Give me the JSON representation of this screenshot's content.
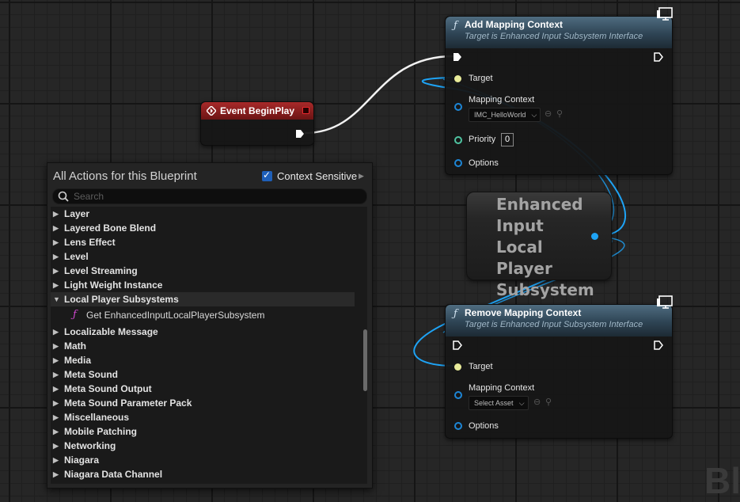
{
  "watermark": "Bl",
  "event_node": {
    "title": "Event BeginPlay"
  },
  "add_node": {
    "title": "Add Mapping Context",
    "subtitle": "Target is Enhanced Input Subsystem Interface",
    "pins": {
      "target": "Target",
      "mapping_context": "Mapping Context",
      "priority": "Priority",
      "options": "Options"
    },
    "mapping_value": "IMC_HelloWorld",
    "priority_value": "0"
  },
  "var_node": {
    "title": "Enhanced Input Local Player Subsystem"
  },
  "remove_node": {
    "title": "Remove Mapping Context",
    "subtitle": "Target is Enhanced Input Subsystem Interface",
    "pins": {
      "target": "Target",
      "mapping_context": "Mapping Context",
      "options": "Options"
    },
    "mapping_value": "Select Asset"
  },
  "menu": {
    "title": "All Actions for this Blueprint",
    "context_label": "Context Sensitive",
    "search_placeholder": "Search",
    "items": [
      "Layer",
      "Layered Bone Blend",
      "Lens Effect",
      "Level",
      "Level Streaming",
      "Light Weight Instance",
      "Local Player Subsystems"
    ],
    "sub_item": "Get EnhancedInputLocalPlayerSubsystem",
    "items_after": [
      "Localizable Message",
      "Math",
      "Media",
      "Meta Sound",
      "Meta Sound Output",
      "Meta Sound Parameter Pack",
      "Miscellaneous",
      "Mobile Patching",
      "Networking",
      "Niagara",
      "Niagara Data Channel"
    ]
  },
  "colors": {
    "accent_red": "#e8282e",
    "wire_blue": "#1ea3f5",
    "fn_pink": "#d048d0"
  }
}
